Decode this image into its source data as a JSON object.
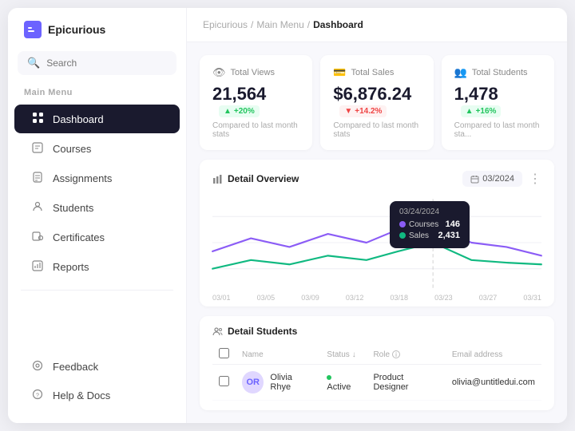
{
  "app": {
    "logo_text": "Epicurious",
    "logo_icon": "E"
  },
  "sidebar": {
    "search_placeholder": "Search",
    "section_label": "Main Menu",
    "items": [
      {
        "id": "dashboard",
        "label": "Dashboard",
        "icon": "⊞",
        "active": true
      },
      {
        "id": "courses",
        "label": "Courses",
        "icon": "📖"
      },
      {
        "id": "assignments",
        "label": "Assignments",
        "icon": "📋"
      },
      {
        "id": "students",
        "label": "Students",
        "icon": "👥"
      },
      {
        "id": "certificates",
        "label": "Certificates",
        "icon": "📄"
      },
      {
        "id": "reports",
        "label": "Reports",
        "icon": "📊"
      }
    ],
    "bottom_items": [
      {
        "id": "feedback",
        "label": "Feedback",
        "icon": "💬"
      },
      {
        "id": "help",
        "label": "Help & Docs",
        "icon": "❓"
      }
    ]
  },
  "breadcrumb": {
    "parts": [
      "Epicurious",
      "Main Menu",
      "Dashboard"
    ],
    "separator": "/"
  },
  "stats": [
    {
      "id": "total-views",
      "icon": "👁",
      "label": "Total Views",
      "value": "21,564",
      "badge": "+20%",
      "badge_type": "green",
      "sub": "Compared to last month stats"
    },
    {
      "id": "total-sales",
      "icon": "💳",
      "label": "Total Sales",
      "value": "$6,876.24",
      "badge": "+14.2%",
      "badge_type": "red",
      "sub": "Compared to last month stats"
    },
    {
      "id": "total-students",
      "icon": "👥",
      "label": "Total Students",
      "value": "1,478",
      "badge": "+16%",
      "badge_type": "green",
      "sub": "Compared to last month sta..."
    }
  ],
  "chart": {
    "title": "Detail Overview",
    "date_label": "03/2024",
    "x_labels": [
      "03/01",
      "03/05",
      "03/09",
      "03/12",
      "03/18",
      "03/23",
      "03/27",
      "03/31"
    ],
    "tooltip": {
      "date": "03/24/2024",
      "courses_label": "Courses",
      "courses_value": "146",
      "sales_label": "Sales",
      "sales_value": "2,431"
    },
    "legend": {
      "courses_color": "#8b5cf6",
      "sales_color": "#10b981"
    }
  },
  "students": {
    "section_title": "Detail Students",
    "columns": [
      "Name",
      "Status",
      "Role",
      "Email address"
    ],
    "rows": [
      {
        "name": "Olivia Rhye",
        "status": "Active",
        "role": "Product Designer",
        "email": "olivia@untitledui.com",
        "initials": "OR"
      }
    ]
  }
}
